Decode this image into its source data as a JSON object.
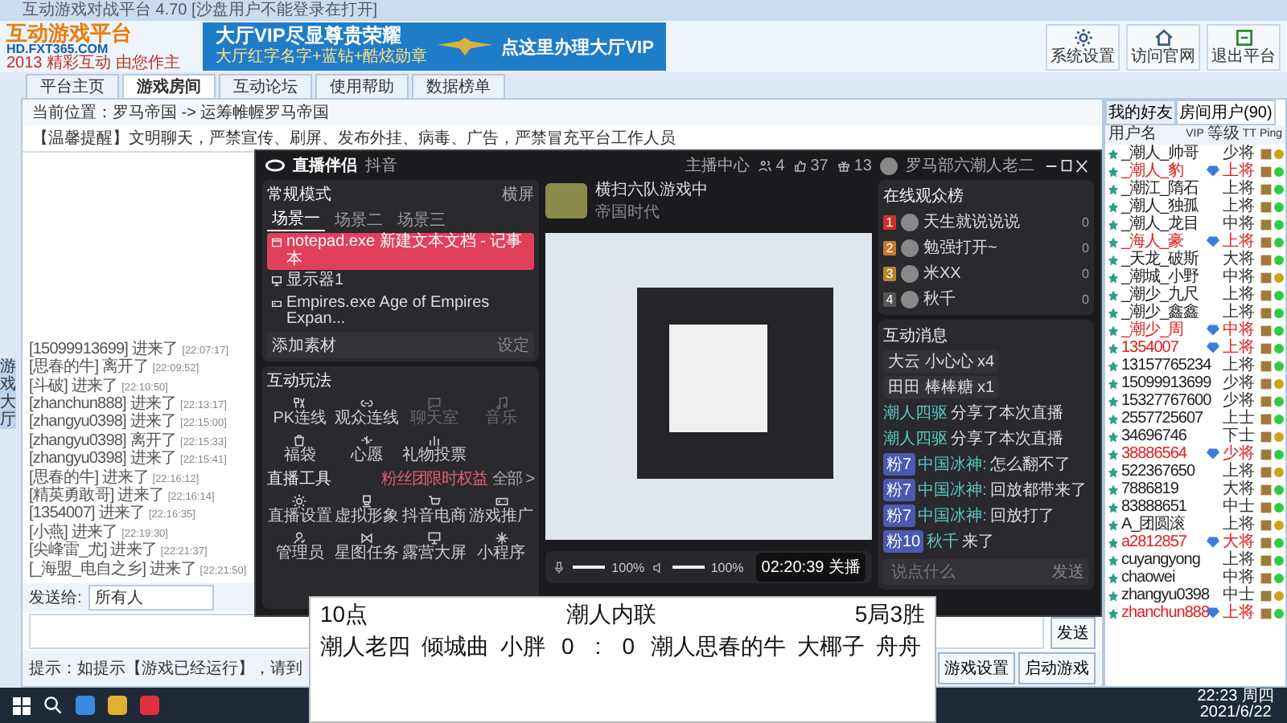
{
  "window": {
    "title": "互动游戏对战平台 4.70 [沙盘用户不能登录在打开]"
  },
  "logo": {
    "name": "互动游戏平台",
    "url": "HD.FXT365.COM",
    "slogan": "2013 精彩互动 由您作主"
  },
  "banner": {
    "headline": "大厅VIP尽显尊贵荣耀",
    "subline": "大厅红字名字+蓝钻+酷炫勋章",
    "cta": "点这里办理大厅VIP"
  },
  "toolbar": [
    "系统设置",
    "访问官网",
    "退出平台"
  ],
  "tabs": [
    {
      "label": "平台主页",
      "selected": false
    },
    {
      "label": "游戏房间",
      "selected": true
    },
    {
      "label": "互动论坛",
      "selected": false
    },
    {
      "label": "使用帮助",
      "selected": false
    },
    {
      "label": "数据榜单",
      "selected": false
    }
  ],
  "breadcrumb": "当前位置：罗马帝国 -> 运筹帷幄罗马帝国",
  "notice": "【温馨提醒】文明聊天，严禁宣传、刷屏、发布外挂、病毒、广告，严禁冒充平台工作人员",
  "side_tab": "游戏大厅",
  "chat_log": [
    {
      "user": "[15099913699]",
      "action": "进来了",
      "time": "[22:07:17]"
    },
    {
      "user": "[思春的牛]",
      "action": "离开了",
      "time": "[22:09:52]"
    },
    {
      "user": "[斗破]",
      "action": "进来了",
      "time": "[22:10:50]"
    },
    {
      "user": "[zhanchun888]",
      "action": "进来了",
      "time": "[22:13:17]"
    },
    {
      "user": "[zhangyu0398]",
      "action": "进来了",
      "time": "[22:15:00]"
    },
    {
      "user": "[zhangyu0398]",
      "action": "离开了",
      "time": "[22:15:33]"
    },
    {
      "user": "[zhangyu0398]",
      "action": "进来了",
      "time": "[22:15:41]"
    },
    {
      "user": "[思春的牛]",
      "action": "进来了",
      "time": "[22:16:12]"
    },
    {
      "user": "[精英勇敢哥]",
      "action": "进来了",
      "time": "[22:16:14]"
    },
    {
      "user": "[1354007]",
      "action": "进来了",
      "time": "[22:16:35]"
    },
    {
      "user": "[小燕]",
      "action": "进来了",
      "time": "[22:19:30]"
    },
    {
      "user": "[尖峰雷_尤]",
      "action": "进来了",
      "time": "[22:21:37]"
    },
    {
      "user": "[_海盟_电自之乡]",
      "action": "进来了",
      "time": "[22:21:50]"
    }
  ],
  "send": {
    "label": "发送给:",
    "recipient": "所有人",
    "button": "发送"
  },
  "tip": "提示：如提示【游戏已经运行】，请到",
  "game_buttons": [
    "游戏设置",
    "启动游戏"
  ],
  "user_panel": {
    "tabs": [
      {
        "label": "我的好友",
        "selected": false
      },
      {
        "label": "房间用户(90)",
        "selected": true
      }
    ],
    "columns": [
      "用户名",
      "VIP",
      "等级",
      "TT",
      "Ping"
    ],
    "rows": [
      {
        "name": "_潮人_帅哥",
        "vip": false,
        "level": "少将",
        "color": "#d4a017"
      },
      {
        "name": "_潮人_豹",
        "vip": true,
        "level": "上将",
        "color": "#2ecc40"
      },
      {
        "name": "_潮江_隋石",
        "vip": false,
        "level": "上将",
        "color": "#2ecc40"
      },
      {
        "name": "_潮人_独孤",
        "vip": false,
        "level": "上将",
        "color": "#2ecc40"
      },
      {
        "name": "_潮人_龙目",
        "vip": false,
        "level": "中将",
        "color": "#2ecc40"
      },
      {
        "name": "_海人_豪",
        "vip": true,
        "level": "上将",
        "color": "#2ecc40"
      },
      {
        "name": "_天龙_破斯",
        "vip": false,
        "level": "大将",
        "color": "#2ecc40"
      },
      {
        "name": "_潮城_小野",
        "vip": false,
        "level": "中将",
        "color": "#d4a017"
      },
      {
        "name": "_潮少_九尺",
        "vip": false,
        "level": "上将",
        "color": "#2ecc40"
      },
      {
        "name": "_潮少_鑫鑫",
        "vip": false,
        "level": "上将",
        "color": "#2ecc40"
      },
      {
        "name": "_潮少_周",
        "vip": true,
        "level": "中将",
        "color": "#2ecc40"
      },
      {
        "name": "1354007",
        "vip": true,
        "level": "上将",
        "color": "#2ecc40"
      },
      {
        "name": "13157765234",
        "vip": false,
        "level": "上将",
        "color": "#2ecc40"
      },
      {
        "name": "15099913699",
        "vip": false,
        "level": "少将",
        "color": "#d4a017"
      },
      {
        "name": "15327767600",
        "vip": false,
        "level": "少将",
        "color": "#2ecc40"
      },
      {
        "name": "2557725607",
        "vip": false,
        "level": "上士",
        "color": "#2ecc40"
      },
      {
        "name": "34696746",
        "vip": false,
        "level": "下士",
        "color": "#d4a017"
      },
      {
        "name": "38886564",
        "vip": true,
        "level": "少将",
        "color": "#2ecc40"
      },
      {
        "name": "522367650",
        "vip": false,
        "level": "上将",
        "color": "#d4a017"
      },
      {
        "name": "7886819",
        "vip": false,
        "level": "大将",
        "color": "#2ecc40"
      },
      {
        "name": "83888651",
        "vip": false,
        "level": "中士",
        "color": "#2ecc40"
      },
      {
        "name": "A_团圆滚",
        "vip": false,
        "level": "上将",
        "color": "#d4a017"
      },
      {
        "name": "a2812857",
        "vip": true,
        "level": "大将",
        "color": "#2ecc40"
      },
      {
        "name": "cuyangyong",
        "vip": false,
        "level": "上将",
        "color": "#2ecc40"
      },
      {
        "name": "chaowei",
        "vip": false,
        "level": "中将",
        "color": "#2ecc40"
      },
      {
        "name": "zhangyu0398",
        "vip": false,
        "level": "中士",
        "color": "#d4a017"
      },
      {
        "name": "zhanchun888",
        "vip": true,
        "level": "上将",
        "color": "#2ecc40"
      }
    ]
  },
  "live_window": {
    "app_name": "直播伴侣",
    "platform": "抖音",
    "mode": "常规模式",
    "orientation": "横屏",
    "scenes": [
      {
        "label": "场景一",
        "selected": true
      },
      {
        "label": "场景二",
        "selected": false
      },
      {
        "label": "场景三",
        "selected": false
      }
    ],
    "sources": [
      {
        "kind": "window",
        "label": "notepad.exe 新建文本文档 - 记事本",
        "selected": true
      },
      {
        "kind": "display",
        "label": "显示器1",
        "selected": false
      },
      {
        "kind": "game",
        "label": "Empires.exe Age of Empires Expan...",
        "selected": false
      }
    ],
    "add_source": "添加素材",
    "source_settings": "设定",
    "interactive": {
      "title": "互动玩法",
      "items": [
        {
          "label": "PK连线",
          "disabled": false
        },
        {
          "label": "观众连线",
          "disabled": false
        },
        {
          "label": "聊天室",
          "disabled": true
        },
        {
          "label": "音乐",
          "disabled": true
        },
        {
          "label": "福袋",
          "disabled": false
        },
        {
          "label": "心愿",
          "disabled": false
        },
        {
          "label": "礼物投票",
          "disabled": false
        }
      ]
    },
    "tools": {
      "title": "直播工具",
      "promo": "粉丝团限时权益",
      "more": "全部 >",
      "items": [
        "直播设置",
        "虚拟形象",
        "抖音电商",
        "游戏推广",
        "管理员",
        "星图任务",
        "露营大屏",
        "小程序"
      ]
    },
    "room": {
      "title": "横扫六队游戏中",
      "category": "帝国时代"
    },
    "host_center": "主播中心",
    "stats": [
      "4",
      "37",
      "13"
    ],
    "account": "罗马部六潮人老二",
    "audience": {
      "title": "在线观众榜",
      "rows": [
        {
          "rank": "1",
          "name": "天生就说说说",
          "score": "0",
          "color": "#d0312d"
        },
        {
          "rank": "2",
          "name": "勉强打开~",
          "score": "0",
          "color": "#c8782a"
        },
        {
          "rank": "3",
          "name": "米XX",
          "score": "0",
          "color": "#b8862a"
        },
        {
          "rank": "4",
          "name": "秋千",
          "score": "0",
          "color": "#555555"
        }
      ]
    },
    "messages": {
      "title": "互动消息",
      "gifts": [
        {
          "user": "大云",
          "gift": "小心心",
          "count": "x4"
        },
        {
          "user": "田田",
          "gift": "棒棒糖",
          "count": "x1"
        }
      ],
      "feed": [
        {
          "kind": "share",
          "user": "潮人四驱",
          "text": "分享了本次直播"
        },
        {
          "kind": "share",
          "user": "潮人四驱",
          "text": "分享了本次直播"
        },
        {
          "kind": "chat",
          "badge": "粉7",
          "user": "中国冰神:",
          "text": "怎么翻不了"
        },
        {
          "kind": "chat",
          "badge": "粉7",
          "user": "中国冰神:",
          "text": "回放都带来了"
        },
        {
          "kind": "chat",
          "badge": "粉7",
          "user": "中国冰神:",
          "text": "回放打了"
        },
        {
          "kind": "chat",
          "badge": "粉10",
          "user": "秋千",
          "text": "来了"
        }
      ],
      "placeholder": "说点什么",
      "send": "发送"
    },
    "controls": {
      "mic": {
        "level": 1.0,
        "reading": "100%"
      },
      "speaker": {
        "level": 1.0,
        "reading": "100%"
      },
      "timer": "02:20:39",
      "end": "关播"
    }
  },
  "score_window": {
    "round": "10点",
    "title": "潮人内联",
    "format": "5局3胜",
    "left_team": [
      "潮人老四",
      "倾城曲",
      "小胖"
    ],
    "left_score": "0",
    "separator": ":",
    "right_score": "0",
    "right_team": [
      "潮人思春的牛",
      "大椰子",
      "舟舟"
    ]
  },
  "taskbar": {
    "time": "22:23 周四",
    "date": "2021/6/22"
  }
}
